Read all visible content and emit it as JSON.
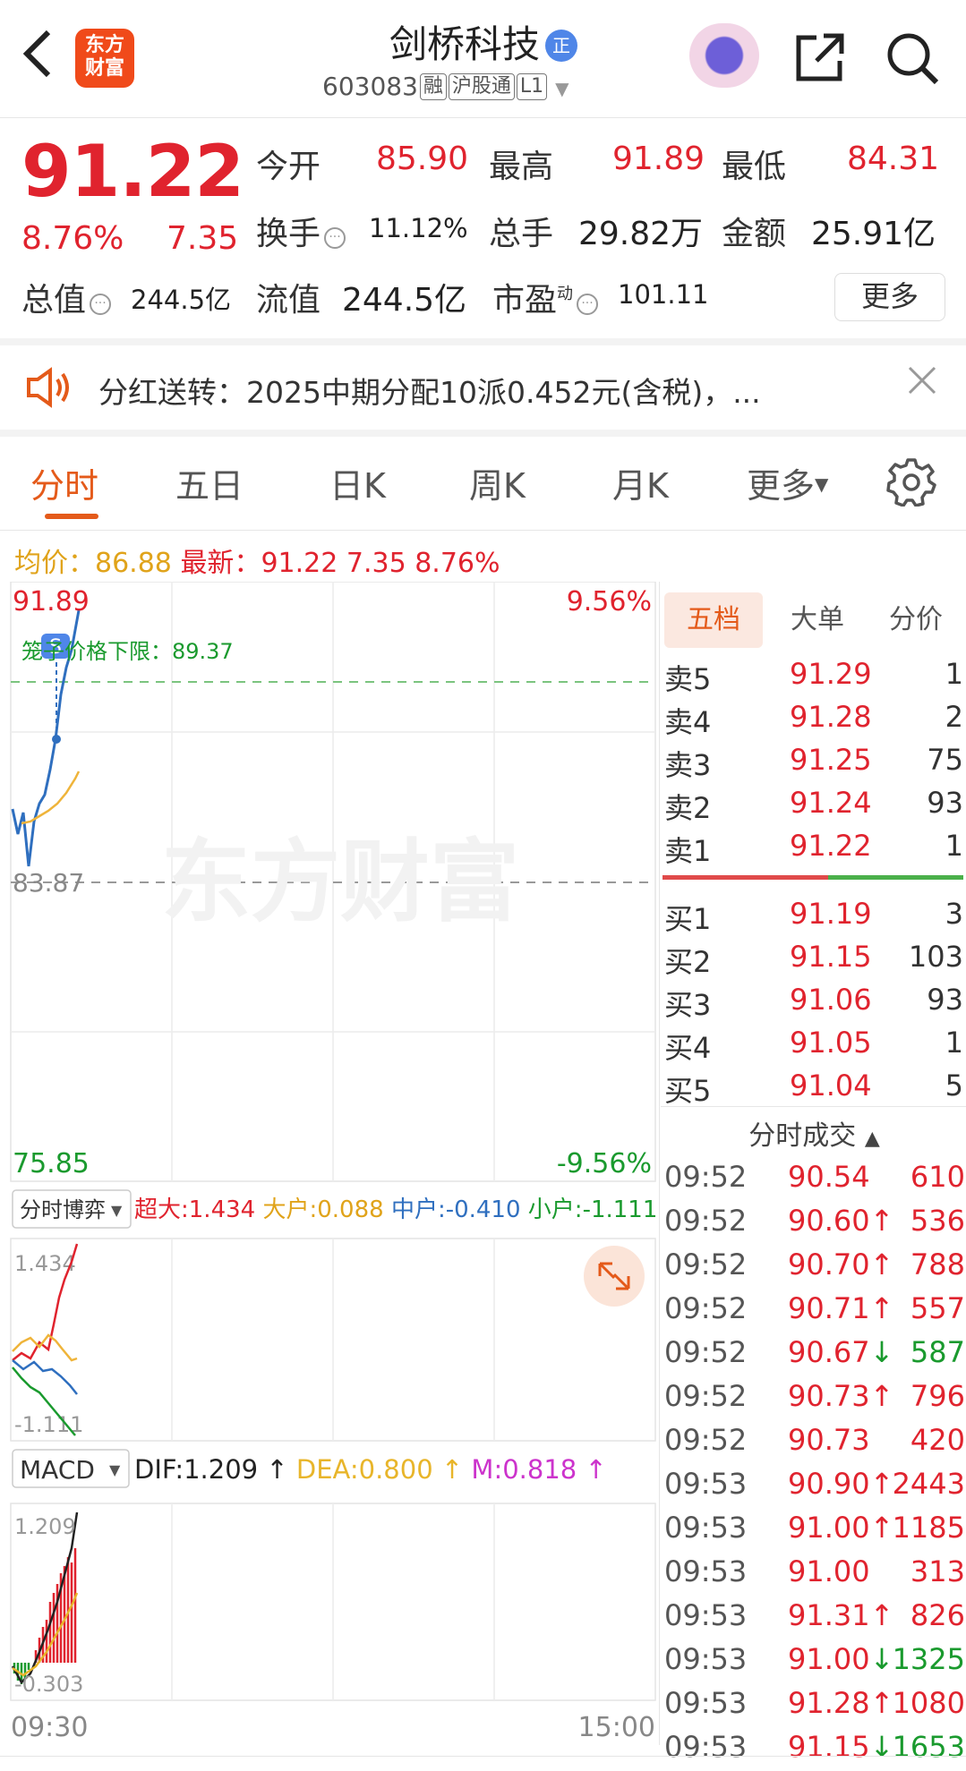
{
  "header": {
    "back_label": "‹",
    "logo_text_1": "东方",
    "logo_text_2": "财富",
    "title": "剑桥科技",
    "title_badge": "正",
    "code": "603083",
    "tags": [
      "融",
      "沪股通",
      "L1"
    ]
  },
  "quote": {
    "price": "91.22",
    "change_pct": "8.76%",
    "change": "7.35",
    "open_label": "今开",
    "open": "85.90",
    "high_label": "最高",
    "high": "91.89",
    "low_label": "最低",
    "low": "84.31",
    "turnover_label": "换手",
    "turnover": "11.12%",
    "volume_label": "总手",
    "volume": "29.82万",
    "amount_label": "金额",
    "amount": "25.91亿",
    "mktcap_label": "总值",
    "mktcap": "244.5亿",
    "float_label": "流值",
    "float": "244.5亿",
    "pe_label": "市盈",
    "pe_sup": "动",
    "pe": "101.11",
    "more_label": "更多"
  },
  "notice": {
    "text": "分红送转：2025中期分配10派0.452元(含税)，..."
  },
  "tabs": [
    "分时",
    "五日",
    "日K",
    "周K",
    "月K",
    "更多"
  ],
  "infoline": {
    "avg_label": "均价：",
    "avg": "86.88",
    "latest_label": "最新：",
    "latest": "91.22",
    "chg": "7.35",
    "pct": "8.76%"
  },
  "chart": {
    "top_price": "91.89",
    "top_pct": "9.56%",
    "mid_price": "83.87",
    "bottom_price": "75.85",
    "bottom_pct": "-9.56%",
    "limit_label": "笼子价格下限：89.37",
    "watermark": "东方财富",
    "flow_select": "分时博弈",
    "flow_super_label": "超大:",
    "flow_super": "1.434",
    "flow_big_label": "大户:",
    "flow_big": "0.088",
    "flow_mid_label": "中户:",
    "flow_mid": "-0.410",
    "flow_small_label": "小户:",
    "flow_small": "-1.111",
    "flow_max": "1.434",
    "flow_min": "-1.111",
    "macd_select": "MACD",
    "dif_label": "DIF:",
    "dif": "1.209",
    "dea_label": "DEA:",
    "dea": "0.800",
    "m_label": "M:",
    "m": "0.818",
    "macd_max": "1.209",
    "macd_min": "-0.303",
    "time_start": "09:30",
    "time_end": "15:00"
  },
  "orderbook": {
    "tabs": [
      "五档",
      "大单",
      "分价"
    ],
    "asks": [
      {
        "label": "卖5",
        "price": "91.29",
        "vol": "1"
      },
      {
        "label": "卖4",
        "price": "91.28",
        "vol": "2"
      },
      {
        "label": "卖3",
        "price": "91.25",
        "vol": "75"
      },
      {
        "label": "卖2",
        "price": "91.24",
        "vol": "93"
      },
      {
        "label": "卖1",
        "price": "91.22",
        "vol": "1"
      }
    ],
    "bids": [
      {
        "label": "买1",
        "price": "91.19",
        "vol": "3"
      },
      {
        "label": "买2",
        "price": "91.15",
        "vol": "103"
      },
      {
        "label": "买3",
        "price": "91.06",
        "vol": "93"
      },
      {
        "label": "买4",
        "price": "91.05",
        "vol": "1"
      },
      {
        "label": "买5",
        "price": "91.04",
        "vol": "5"
      }
    ],
    "trades_title": "分时成交",
    "trades": [
      {
        "time": "09:52",
        "price": "90.54",
        "arrow": "",
        "vol": "610",
        "dir": "red"
      },
      {
        "time": "09:52",
        "price": "90.60",
        "arrow": "↑",
        "vol": "536",
        "dir": "red"
      },
      {
        "time": "09:52",
        "price": "90.70",
        "arrow": "↑",
        "vol": "788",
        "dir": "red"
      },
      {
        "time": "09:52",
        "price": "90.71",
        "arrow": "↑",
        "vol": "557",
        "dir": "red"
      },
      {
        "time": "09:52",
        "price": "90.67",
        "arrow": "↓",
        "vol": "587",
        "dir": "green"
      },
      {
        "time": "09:52",
        "price": "90.73",
        "arrow": "↑",
        "vol": "796",
        "dir": "red"
      },
      {
        "time": "09:52",
        "price": "90.73",
        "arrow": "",
        "vol": "420",
        "dir": "red"
      },
      {
        "time": "09:53",
        "price": "90.90",
        "arrow": "↑",
        "vol": "2443",
        "dir": "red"
      },
      {
        "time": "09:53",
        "price": "91.00",
        "arrow": "↑",
        "vol": "1185",
        "dir": "red"
      },
      {
        "time": "09:53",
        "price": "91.00",
        "arrow": "",
        "vol": "313",
        "dir": "red"
      },
      {
        "time": "09:53",
        "price": "91.31",
        "arrow": "↑",
        "vol": "826",
        "dir": "red"
      },
      {
        "time": "09:53",
        "price": "91.00",
        "arrow": "↓",
        "vol": "1325",
        "dir": "green"
      },
      {
        "time": "09:53",
        "price": "91.28",
        "arrow": "↑",
        "vol": "1080",
        "dir": "red"
      },
      {
        "time": "09:53",
        "price": "91.15",
        "arrow": "↓",
        "vol": "1653",
        "dir": "green"
      }
    ]
  },
  "colors": {
    "up": "#e0232e",
    "down": "#1a9a2e",
    "accent": "#e45a1a",
    "avg": "#e0a31a"
  }
}
